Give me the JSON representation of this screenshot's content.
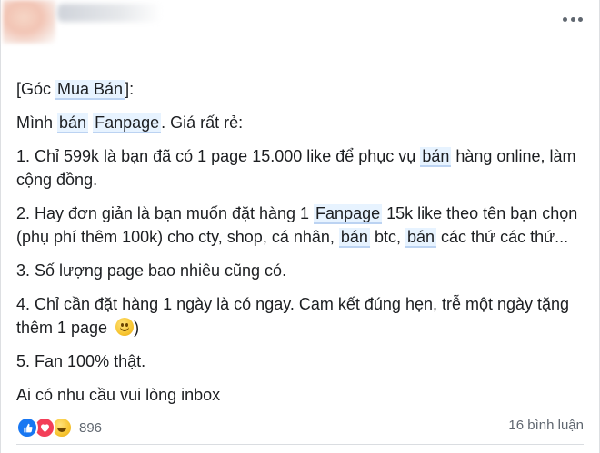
{
  "post": {
    "lines": {
      "l1_pre": "[Góc ",
      "l1_tag": "Mua Bán",
      "l1_post": "]:",
      "l2_pre": "Mình ",
      "l2_tag1": "bán",
      "l2_mid": " ",
      "l2_tag2": "Fanpage",
      "l2_post": ". Giá rất rẻ:",
      "l3_pre": "1. Chỉ 599k là bạn đã có 1 page 15.000 like để phục vụ ",
      "l3_tag": "bán",
      "l3_post": " hàng online, làm cộng đồng.",
      "l4_pre": "2. Hay đơn giản là bạn muốn đặt hàng 1 ",
      "l4_tag1": "Fanpage",
      "l4_mid1": " 15k like theo tên bạn chọn (phụ phí thêm 100k) cho cty, shop, cá nhân, ",
      "l4_tag2": "bán",
      "l4_mid2": " btc, ",
      "l4_tag3": "bán",
      "l4_post": " các thứ các thứ...",
      "l5": "3. Số lượng page bao nhiêu cũng có.",
      "l6_pre": "4. Chỉ cần đặt hàng 1 ngày là có ngay. Cam kết đúng hẹn, trễ một ngày tặng thêm 1 page ",
      "l6_post": ")",
      "l7": "5. Fan 100% thật.",
      "l8": "Ai có nhu cầu vui lòng inbox"
    }
  },
  "footer": {
    "reaction_count": "896",
    "comments": "16 bình luận"
  },
  "icons": {
    "like": "like-icon",
    "love": "love-icon",
    "haha": "haha-icon",
    "more": "more-options-icon"
  },
  "colors": {
    "tag_bg": "#e7f3ff",
    "like": "#1877f2",
    "love": "#f33e58"
  }
}
